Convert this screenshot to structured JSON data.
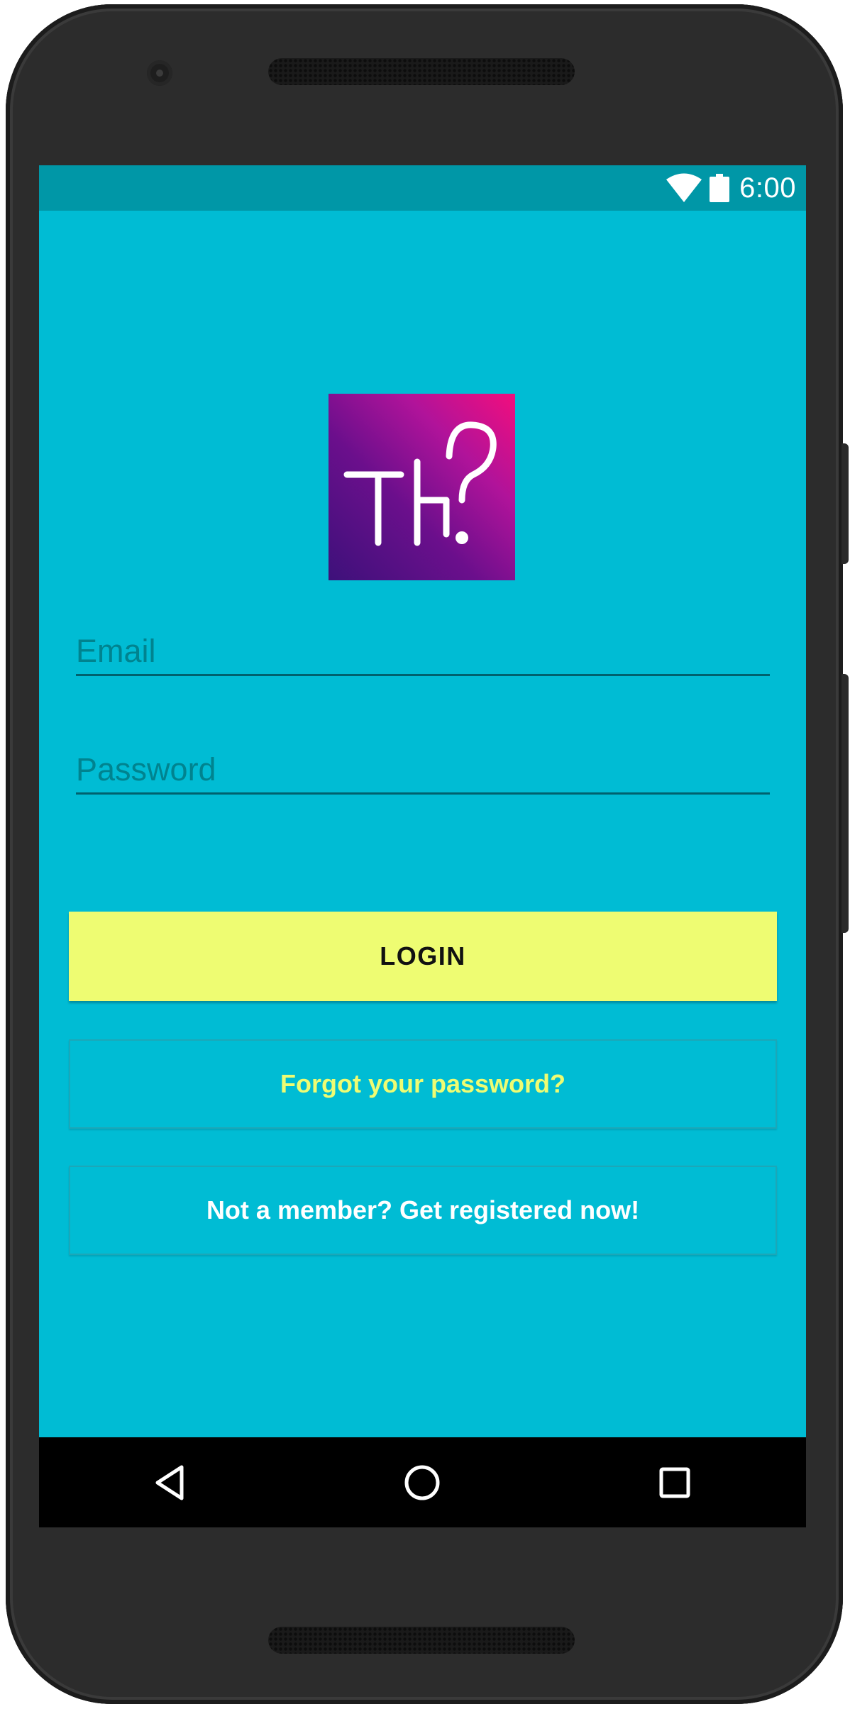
{
  "status_bar": {
    "time": "6:00",
    "icons": [
      "wifi-icon",
      "battery-icon"
    ]
  },
  "logo": {
    "text": "TH?",
    "gradient_colors": [
      "#3d117a",
      "#f20e7d"
    ]
  },
  "form": {
    "email_placeholder": "Email",
    "email_value": "",
    "password_placeholder": "Password",
    "password_value": ""
  },
  "buttons": {
    "login_label": "LOGIN",
    "forgot_label": "Forgot your password?",
    "register_label": "Not a member? Get registered now!"
  },
  "nav_bar": {
    "icons": [
      "back-icon",
      "home-icon",
      "recents-icon"
    ]
  },
  "colors": {
    "background": "#00bcd4",
    "status_bar": "#0097a7",
    "login_button": "#eefc72",
    "forgot_text": "#eefc72",
    "register_text": "#ffffff"
  }
}
